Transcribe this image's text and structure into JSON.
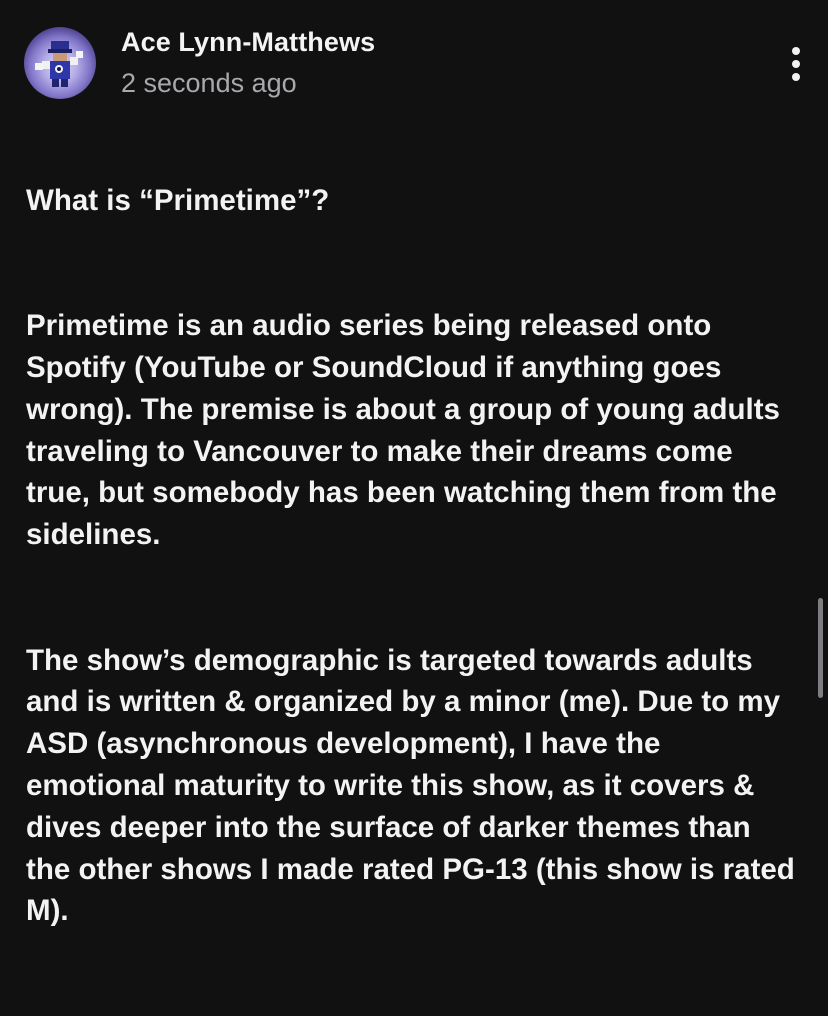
{
  "post": {
    "author": "Ace Lynn-Matthews",
    "timestamp": "2 seconds ago",
    "more_icon": "vertical-ellipsis-icon",
    "paragraphs": [
      "What is “Primetime”?",
      "Primetime is an audio series being released onto Spotify (YouTube or SoundCloud if anything goes wrong). The premise is about a group of young adults traveling to Vancouver to make their dreams come true, but somebody has been watching them from the sidelines.",
      "The show’s demographic is targeted towards adults and is written & organized by a minor (me). Due to my ASD (asynchronous development), I have the emotional maturity to write this show, as it covers & dives deeper into the surface of darker themes than the other shows I made rated PG-13 (this show is rated M)."
    ]
  },
  "colors": {
    "background": "#111112",
    "text": "#f3f3f3",
    "secondary_text": "#a8a8ad"
  }
}
